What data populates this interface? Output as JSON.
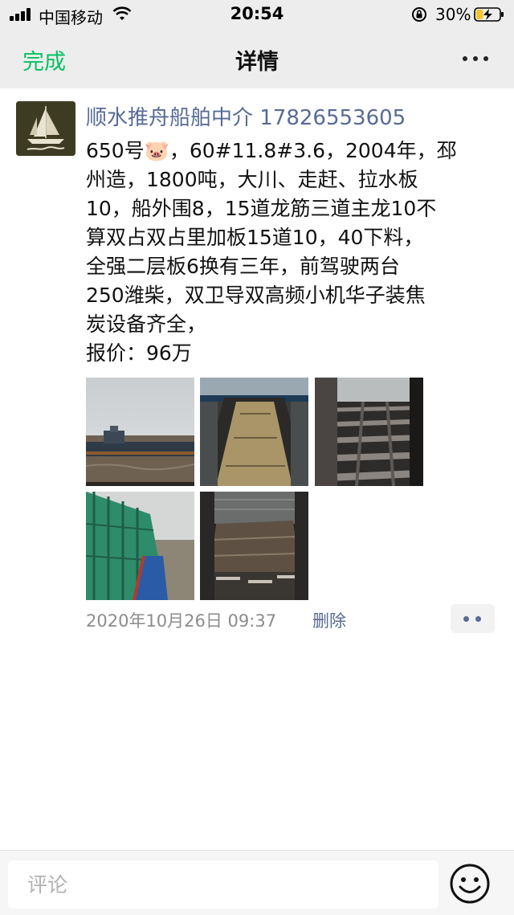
{
  "status_bar": {
    "carrier": "中国移动",
    "time": "20:54",
    "battery_percent": "30%",
    "battery_level": 0.3,
    "icons": [
      "signal-icon",
      "wifi-icon",
      "orientation-lock-icon",
      "battery-charging-icon"
    ]
  },
  "nav": {
    "done_label": "完成",
    "title": "详情",
    "more_icon": "more-icon"
  },
  "post": {
    "author": "顺水推舟船舶中介 17826553605",
    "lines": [
      "650号🐷，60#11.8#3.6，2004年，邳",
      "州造，1800吨，大川、走赶、拉水板",
      "10，船外围8，15道龙筋三道主龙10不",
      "算双占双占里加板15道10，40下料，",
      "全强二层板6换有三年，前驾驶两台",
      "250潍柴，双卫导双高频小机华子装焦",
      "炭设备齐全，",
      "报价：96万"
    ],
    "photos": [
      {
        "name": "photo-barge-river"
      },
      {
        "name": "photo-cargo-hold-front"
      },
      {
        "name": "photo-hold-beams"
      },
      {
        "name": "photo-deck-side"
      },
      {
        "name": "photo-hold-interior"
      }
    ],
    "timestamp": "2020年10月26日 09:37",
    "delete_label": "删除"
  },
  "comment_bar": {
    "placeholder": "评论",
    "emoji_icon": "smiley-icon"
  },
  "colors": {
    "accent_green": "#07c160",
    "link_blue": "#576b95",
    "bar_gray": "#ededed",
    "meta_gray": "#8c8c8c"
  }
}
